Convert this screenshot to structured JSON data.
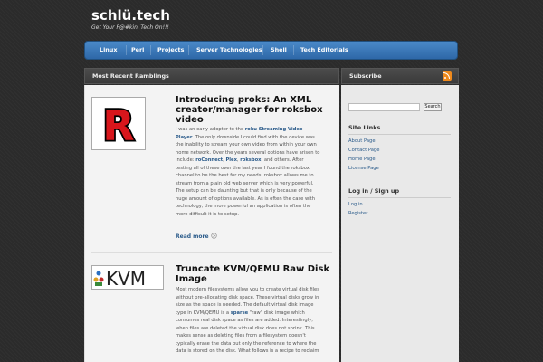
{
  "site": {
    "title": "schlü.tech",
    "tagline": "Get Your F@#kin' Tech On!!!"
  },
  "nav": {
    "items": [
      "Linux",
      "Perl",
      "Projects",
      "Server Technologies",
      "Shell",
      "Tech Editorials"
    ]
  },
  "main": {
    "header": "Most Recent Ramblings",
    "posts": [
      {
        "title_lines": [
          "Introducing proks: An XML",
          "creator/manager for roksbox",
          "video"
        ],
        "body_lines": [
          [
            "I was an early adopter to the ",
            {
              "b": "roku Streaming Video"
            }
          ],
          [
            {
              "b": "Player"
            },
            ". The only downside I could find with the device was"
          ],
          [
            "the inability to stream your own video from within your own"
          ],
          [
            "home network. Over the years several options have arisen to"
          ],
          [
            "include: ",
            {
              "b": "roConnect"
            },
            ", ",
            {
              "b": "Plex"
            },
            ", ",
            {
              "b": "roksbox"
            },
            ", and others. After"
          ],
          [
            "testing all of these over the last year I found the roksbox"
          ],
          [
            "channel to be the best for my needs. roksbox allows me to"
          ],
          [
            "stream from a plain old web server which is very powerful."
          ],
          [
            "The setup can be daunting but that is only because of the"
          ],
          [
            "huge amount of options available. As is often the case with"
          ],
          [
            "technology, the more powerful an application is often the"
          ],
          [
            "more difficult it is to setup."
          ]
        ],
        "read_more": "Read more"
      },
      {
        "title_lines": [
          "Truncate KVM/QEMU Raw Disk",
          "Image"
        ],
        "body_lines": [
          [
            "Most modern filesystems allow you to create virtual disk files"
          ],
          [
            "without pre-allocating disk space. These virtual disks grow in"
          ],
          [
            "size as the space is needed. The default virtual disk image"
          ],
          [
            "type in KVM/QEMU is a ",
            {
              "b": "sparse"
            },
            " \"raw\" disk image which"
          ],
          [
            "consumes real disk space as files are added. Interestingly,"
          ],
          [
            "when files are deleted the virtual disk does not shrink. This"
          ],
          [
            "makes sense as deleting files from a filesystem doesn't"
          ],
          [
            "typically erase the data but only the reference to where the"
          ],
          [
            "data is stored on the disk. What follows is a recipe to reclaim"
          ]
        ]
      }
    ]
  },
  "sidebar": {
    "header": "Subscribe",
    "search_button": "Search",
    "site_links_title": "Site Links",
    "site_links": [
      "About Page",
      "Contact Page",
      "Home Page",
      "License Page"
    ],
    "login_title": "Log in / Sign up",
    "login_links": [
      "Log in",
      "Register"
    ]
  },
  "logos": {
    "thumb1_letter": "R",
    "thumb2_text": "KVM"
  },
  "colors": {
    "nav_blue": "#3a78b8",
    "link_blue": "#2b5b8a",
    "rss_orange": "#f08a1c",
    "logo_red": "#d8161c"
  }
}
